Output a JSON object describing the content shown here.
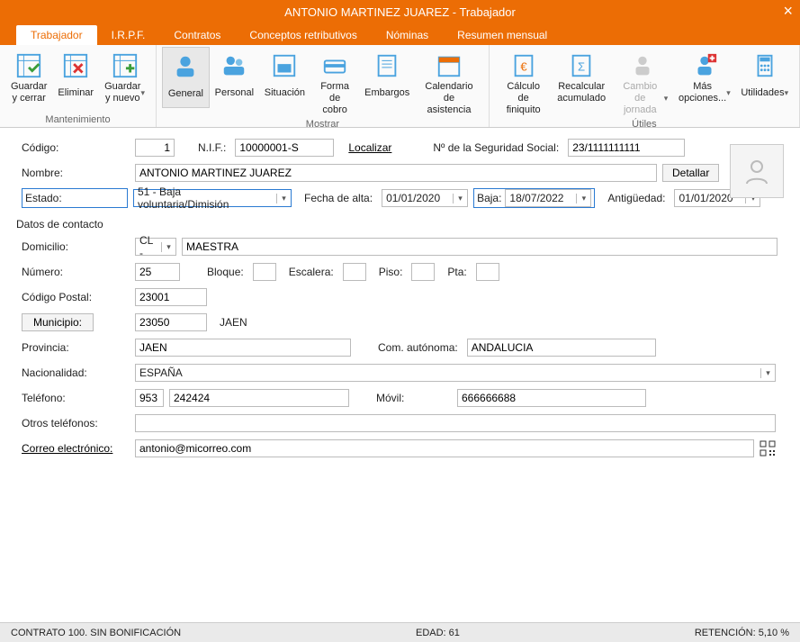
{
  "window": {
    "title": "ANTONIO MARTINEZ JUAREZ - Trabajador"
  },
  "tabs": {
    "items": [
      {
        "label": "Trabajador",
        "active": true
      },
      {
        "label": "I.R.P.F."
      },
      {
        "label": "Contratos"
      },
      {
        "label": "Conceptos retributivos"
      },
      {
        "label": "Nóminas"
      },
      {
        "label": "Resumen mensual"
      }
    ]
  },
  "ribbon": {
    "groups": {
      "mantenimiento": {
        "label": "Mantenimiento",
        "guardar_cerrar": "Guardar\ny cerrar",
        "eliminar": "Eliminar",
        "guardar_nuevo": "Guardar\ny nuevo"
      },
      "mostrar": {
        "label": "Mostrar",
        "general": "General",
        "personal": "Personal",
        "situacion": "Situación",
        "forma_cobro": "Forma\nde cobro",
        "embargos": "Embargos",
        "calendario": "Calendario\nde asistencia"
      },
      "utiles": {
        "label": "Útiles",
        "calculo_finiquito": "Cálculo de\nfiniquito",
        "recalcular": "Recalcular\nacumulado",
        "cambio_jornada": "Cambio de\njornada",
        "mas_opciones": "Más\nopciones...",
        "utilidades": "Utilidades"
      }
    }
  },
  "top": {
    "codigo_label": "Código:",
    "codigo": "1",
    "nif_label": "N.I.F.:",
    "nif": "10000001-S",
    "localizar": "Localizar",
    "nss_label": "Nº de la Seguridad Social:",
    "nss": "23/1111111111",
    "nombre_label": "Nombre:",
    "nombre": "ANTONIO MARTINEZ JUAREZ",
    "detallar": "Detallar",
    "estado_label": "Estado:",
    "estado": "51 - Baja voluntaria/Dimisión",
    "fecha_alta_label": "Fecha de alta:",
    "fecha_alta": "01/01/2020",
    "baja_label": "Baja:",
    "baja": "18/07/2022",
    "antiguedad_label": "Antigüedad:",
    "antiguedad": "01/01/2020"
  },
  "contacto": {
    "section": "Datos de contacto",
    "domicilio_label": "Domicilio:",
    "dom_tipo": "CL -",
    "dom_calle": "MAESTRA",
    "numero_label": "Número:",
    "numero": "25",
    "bloque_label": "Bloque:",
    "bloque": "",
    "escalera_label": "Escalera:",
    "escalera": "",
    "piso_label": "Piso:",
    "piso": "",
    "pta_label": "Pta:",
    "pta": "",
    "cp_label": "Código Postal:",
    "cp": "23001",
    "municipio_label": "Municipio:",
    "municipio_cod": "23050",
    "municipio_nom": "JAEN",
    "provincia_label": "Provincia:",
    "provincia": "JAEN",
    "com_label": "Com. autónoma:",
    "com": "ANDALUCIA",
    "nacionalidad_label": "Nacionalidad:",
    "nacionalidad": "ESPAÑA",
    "telefono_label": "Teléfono:",
    "tel_pref": "953",
    "tel": "242424",
    "movil_label": "Móvil:",
    "movil": "666666688",
    "otros_tel_label": "Otros teléfonos:",
    "otros_tel": "",
    "correo_label": "Correo electrónico:",
    "correo": "antonio@micorreo.com"
  },
  "status": {
    "contrato": "CONTRATO 100.  SIN BONIFICACIÓN",
    "edad": "EDAD: 61",
    "retencion": "RETENCIÓN: 5,10 %"
  }
}
